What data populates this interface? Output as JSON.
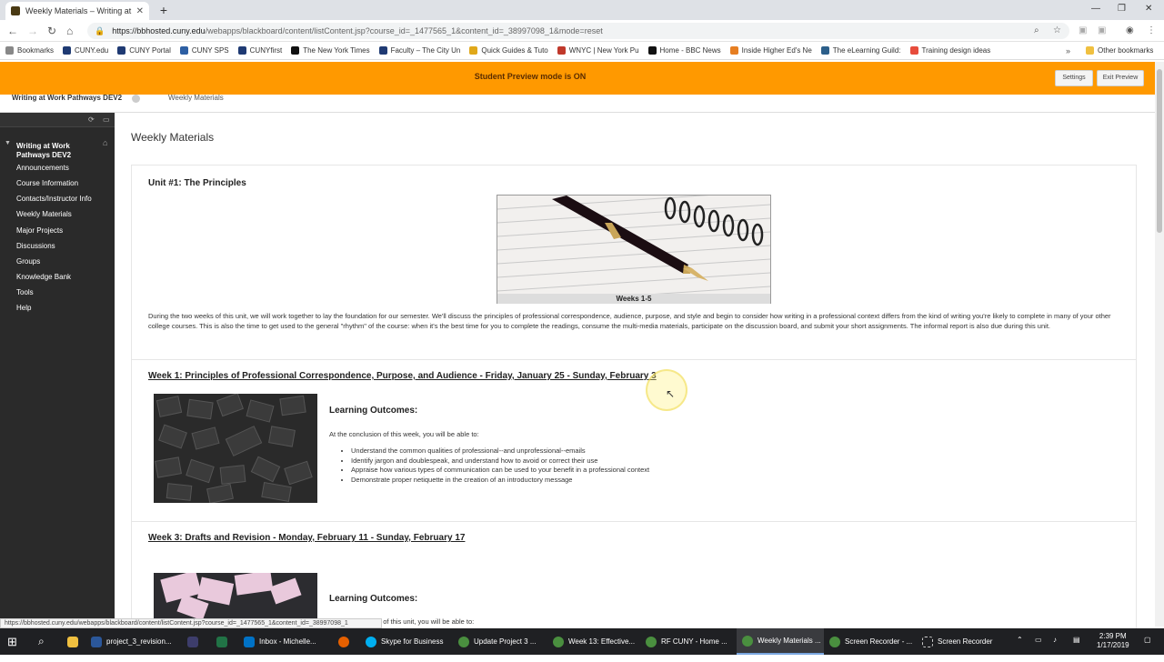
{
  "browser": {
    "tab_title": "Weekly Materials – Writing at W",
    "url_host": "https://bbhosted.cuny.edu",
    "url_path": "/webapps/blackboard/content/listContent.jsp?course_id=_1477565_1&content_id=_38997098_1&mode=reset",
    "bookmarks": [
      "Bookmarks",
      "CUNY.edu",
      "CUNY Portal",
      "CUNY SPS",
      "CUNYfirst",
      "The New York Times",
      "Faculty – The City Un",
      "Quick Guides & Tuto",
      "WNYC | New York Pu",
      "Home - BBC News",
      "Inside Higher Ed's Ne",
      "The eLearning Guild:",
      "Training design ideas"
    ],
    "other_bookmarks": "Other bookmarks",
    "status_url": "https://bbhosted.cuny.edu/webapps/blackboard/content/listContent.jsp?course_id=_1477565_1&content_id=_38997098_1"
  },
  "preview": {
    "message": "Student Preview mode is ON",
    "settings": "Settings",
    "exit": "Exit Preview"
  },
  "breadcrumb": {
    "course": "Writing at Work Pathways DEV2",
    "page": "Weekly Materials"
  },
  "sidebar": {
    "course_title": "Writing at Work Pathways DEV2",
    "items": [
      "Announcements",
      "Course Information",
      "Contacts/Instructor Info",
      "Weekly Materials",
      "Major Projects",
      "Discussions",
      "Groups",
      "Knowledge Bank",
      "Tools",
      "Help"
    ]
  },
  "main": {
    "page_title": "Weekly Materials",
    "unit_title": "Unit #1: The Principles",
    "unit_caption": "Weeks 1-5",
    "unit_text": "During the two weeks of this unit, we will work together to lay the foundation for our semester. We'll discuss the principles of professional correspondence, audience, purpose, and style and begin to consider how writing in a professional context differs from the kind of writing you're likely to complete in many of your other college courses. This is also the time to get used to the general \"rhythm\" of the course: when it's the best time for you to complete the readings, consume the multi-media materials, participate on the discussion board, and submit your short assignments. The informal report is also due during this unit.",
    "week1": {
      "title": "Week 1: Principles of Professional Correspondence, Purpose, and Audience - Friday, January 25 - Sunday, February 3",
      "outcomes_heading": "Learning Outcomes:",
      "intro": "At the conclusion of this week, you will be able to:",
      "bullets": [
        "Understand the common qualities of professional--and unprofessional--emails",
        "Identify jargon and doublespeak, and understand how to avoid or correct their use",
        "Appraise how various types of communication can be used to your benefit in a professional context",
        "Demonstrate proper netiquette in the creation of an introductory message"
      ]
    },
    "week3": {
      "title": "Week 3: Drafts and Revision - Monday, February 11 - Sunday, February 17",
      "outcomes_heading": "Learning Outcomes:",
      "intro": "At the conclusion of this unit, you will be able to:"
    }
  },
  "taskbar": {
    "items": [
      "project_3_revision...",
      "Inbox - Michelle...",
      "Skype for Business",
      "Update Project 3 ...",
      "Week 13: Effective...",
      "RF CUNY - Home ...",
      "Weekly Materials ...",
      "Screen Recorder - ...",
      "Screen Recorder"
    ],
    "time": "2:39 PM",
    "date": "1/17/2019"
  }
}
